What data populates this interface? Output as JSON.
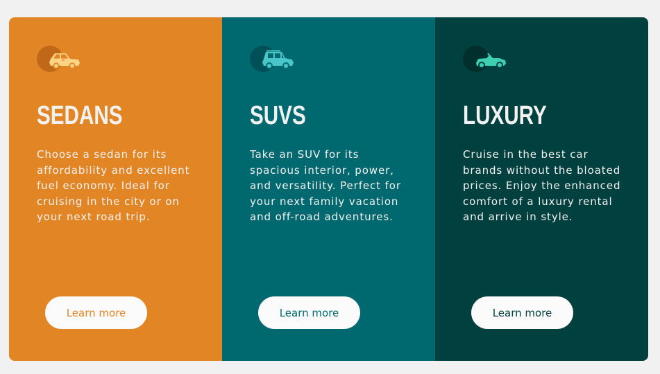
{
  "cards": [
    {
      "title": "SEDANS",
      "description": "Choose a sedan for its affordability and excellent fuel economy. Ideal for cruising in the city or on your next road trip.",
      "button_label": "Learn more",
      "icon": "sedan-car-icon",
      "background": "#e28625",
      "icon_color": "#fcd387"
    },
    {
      "title": "SUVS",
      "description": "Take an SUV for its spacious interior, power, and versatility. Perfect for your next family vacation and off-road adventures.",
      "button_label": "Learn more",
      "icon": "suv-car-icon",
      "background": "#006970",
      "icon_color": "#49c6c8"
    },
    {
      "title": "LUXURY",
      "description": "Cruise in the best car brands without the bloated prices. Enjoy the enhanced comfort of a luxury rental and arrive in style.",
      "button_label": "Learn more",
      "icon": "luxury-car-icon",
      "background": "#00403f",
      "icon_color": "#3ed0b3"
    }
  ],
  "colors": {
    "page_background": "#f1f1f1",
    "text_light": "#f2f2f2",
    "button_background": "#fbfbfb"
  }
}
